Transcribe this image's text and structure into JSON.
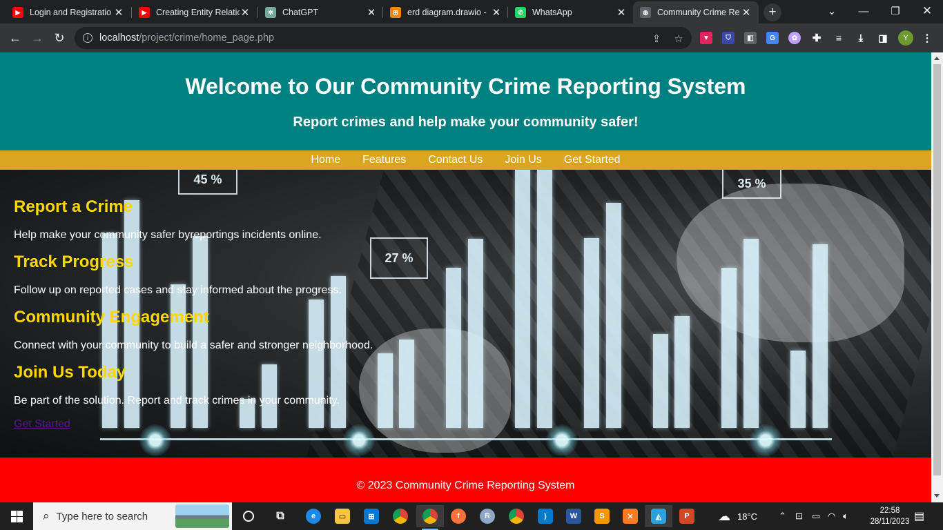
{
  "browser": {
    "tabs": [
      {
        "title": "Login and Registratio",
        "icon": "youtube-icon",
        "active": false
      },
      {
        "title": "Creating Entity Relatic",
        "icon": "youtube-icon",
        "active": false
      },
      {
        "title": "ChatGPT",
        "icon": "chatgpt-icon",
        "active": false
      },
      {
        "title": "erd diagram.drawio -",
        "icon": "drawio-icon",
        "active": false
      },
      {
        "title": "WhatsApp",
        "icon": "whatsapp-icon",
        "active": false
      },
      {
        "title": "Community Crime Re",
        "icon": "globe-icon",
        "active": true
      }
    ],
    "url_host": "localhost",
    "url_path": "/project/crime/home_page.php",
    "profile_initial": "Y"
  },
  "page": {
    "header_title": "Welcome to Our Community Crime Reporting System",
    "header_subtitle": "Report crimes and help make your community safer!",
    "nav": [
      "Home",
      "Features",
      "Contact Us",
      "Join Us",
      "Get Started"
    ],
    "hero_badges": [
      "45 %",
      "27 %",
      "35 %"
    ],
    "features": [
      {
        "title": "Report a Crime",
        "text": "Help make your community safer byreportings incidents online."
      },
      {
        "title": "Track Progress",
        "text": "Follow up on reported cases and stay informed about the progress."
      },
      {
        "title": "Community Engagement",
        "text": "Connect with your community to build a safer and stronger neighborhood."
      },
      {
        "title": "Join Us Today",
        "text": "Be part of the solution. Report and track crimes in your community."
      }
    ],
    "cta_link": "Get Started",
    "footer": "© 2023 Community Crime Reporting System",
    "colors": {
      "header": "#008080",
      "nav": "#daa520",
      "feature_title": "#ffd700",
      "footer": "#ff0000"
    }
  },
  "taskbar": {
    "search_placeholder": "Type here to search",
    "weather": "18°C",
    "time": "22:58",
    "date": "28/11/2023"
  }
}
